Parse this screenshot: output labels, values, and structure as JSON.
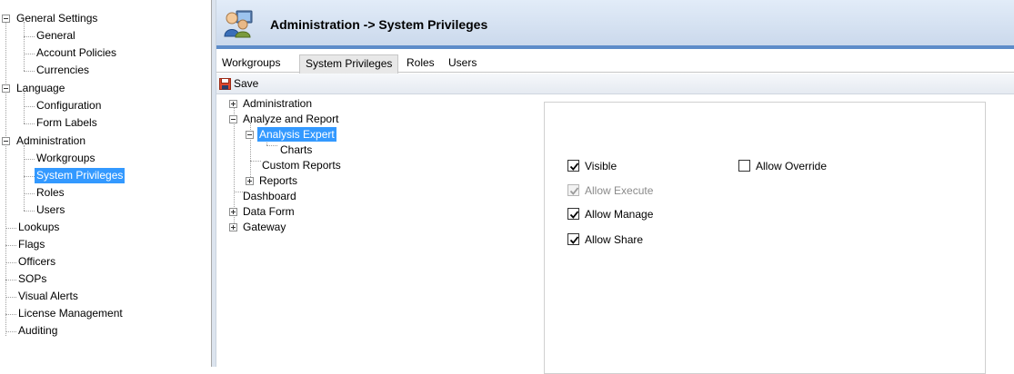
{
  "nav": {
    "general_settings": "General Settings",
    "general": "General",
    "account_policies": "Account Policies",
    "currencies": "Currencies",
    "language": "Language",
    "configuration": "Configuration",
    "form_labels": "Form Labels",
    "administration": "Administration",
    "workgroups": "Workgroups",
    "system_privileges": "System Privileges",
    "roles": "Roles",
    "users": "Users",
    "lookups": "Lookups",
    "flags": "Flags",
    "officers": "Officers",
    "sops": "SOPs",
    "visual_alerts": "Visual Alerts",
    "license_management": "License Management",
    "auditing": "Auditing"
  },
  "header": {
    "title": "Administration  ->  System Privileges"
  },
  "tabs": {
    "workgroups": "Workgroups",
    "system_privileges": "System Privileges",
    "roles": "Roles",
    "users": "Users",
    "active": "System Privileges"
  },
  "toolbar": {
    "save_label": "Save"
  },
  "priv_tree": {
    "administration": "Administration",
    "analyze_and_report": "Analyze and Report",
    "analysis_expert": "Analysis Expert",
    "charts": "Charts",
    "custom_reports": "Custom Reports",
    "reports": "Reports",
    "dashboard": "Dashboard",
    "data_form": "Data Form",
    "gateway": "Gateway"
  },
  "permissions": {
    "visible": {
      "label": "Visible",
      "checked": true,
      "enabled": true
    },
    "allow_override": {
      "label": "Allow Override",
      "checked": false,
      "enabled": true
    },
    "allow_execute": {
      "label": "Allow Execute",
      "checked": true,
      "enabled": false
    },
    "allow_manage": {
      "label": "Allow Manage",
      "checked": true,
      "enabled": true
    },
    "allow_share": {
      "label": "Allow Share",
      "checked": true,
      "enabled": true
    }
  },
  "colors": {
    "selection": "#3399ff",
    "header_accent": "#5d8cc9"
  }
}
